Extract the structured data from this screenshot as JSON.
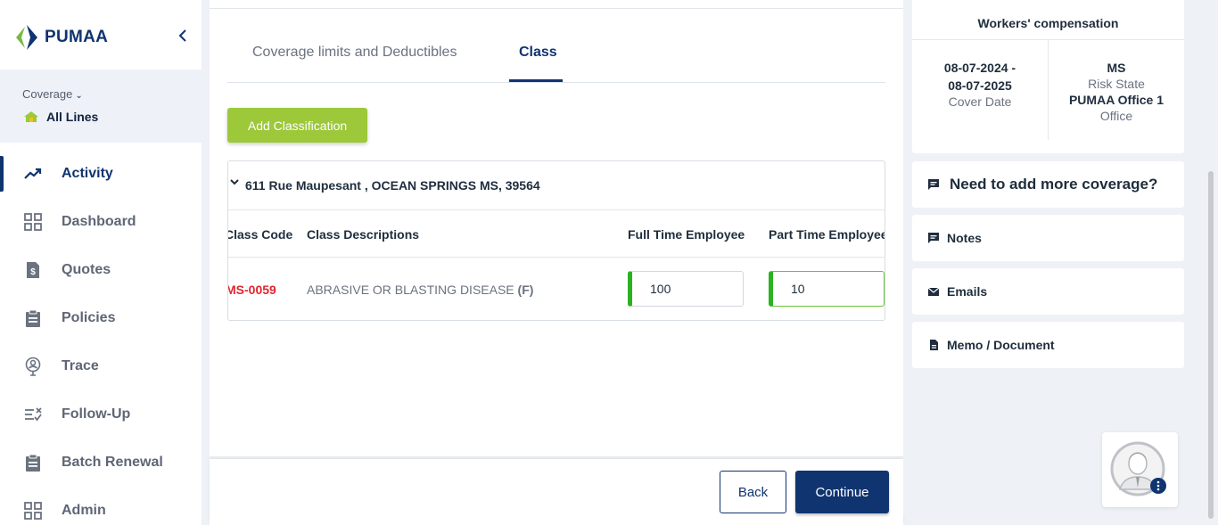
{
  "brand": {
    "name": "PUMAA"
  },
  "sidebar": {
    "coverage_label": "Coverage",
    "coverage_value": "All Lines",
    "items": [
      {
        "label": "Activity",
        "icon": "trending-up-icon",
        "active": true
      },
      {
        "label": "Dashboard",
        "icon": "grid-icon",
        "active": false
      },
      {
        "label": "Quotes",
        "icon": "dollar-document-icon",
        "active": false
      },
      {
        "label": "Policies",
        "icon": "clipboard-icon",
        "active": false
      },
      {
        "label": "Trace",
        "icon": "location-person-icon",
        "active": false
      },
      {
        "label": "Follow-Up",
        "icon": "list-check-icon",
        "active": false
      },
      {
        "label": "Batch Renewal",
        "icon": "clipboard-icon",
        "active": false
      },
      {
        "label": "Admin",
        "icon": "grid-icon",
        "active": false
      }
    ]
  },
  "tabs": [
    {
      "label": "Coverage limits and Deductibles",
      "active": false
    },
    {
      "label": "Class",
      "active": true
    }
  ],
  "add_button": "Add Classification",
  "location": {
    "address": "611 Rue Maupesant , OCEAN SPRINGS MS, 39564",
    "columns": {
      "code": "Class Code",
      "desc": "Class Descriptions",
      "full": "Full Time Employee",
      "part": "Part Time Employee"
    },
    "rows": [
      {
        "code": "MS-0059",
        "desc": "ABRASIVE OR BLASTING DISEASE",
        "suffix": "(F)",
        "full_time": "100",
        "part_time": "10"
      }
    ]
  },
  "footer": {
    "back": "Back",
    "continue": "Continue"
  },
  "policy": {
    "type": "Workers' compensation",
    "date_start": "08-07-2024 -",
    "date_end": "08-07-2025",
    "date_label": "Cover Date",
    "state": "MS",
    "state_label": "Risk State",
    "office": "PUMAA Office 1",
    "office_label": "Office"
  },
  "right_panel": {
    "more_coverage": "Need to add more coverage?",
    "notes": "Notes",
    "emails": "Emails",
    "memo": "Memo / Document"
  },
  "colors": {
    "primary": "#0f3470",
    "accent_green": "#9cc83a",
    "input_green": "#2bb21f",
    "code_red": "#e0262f"
  }
}
